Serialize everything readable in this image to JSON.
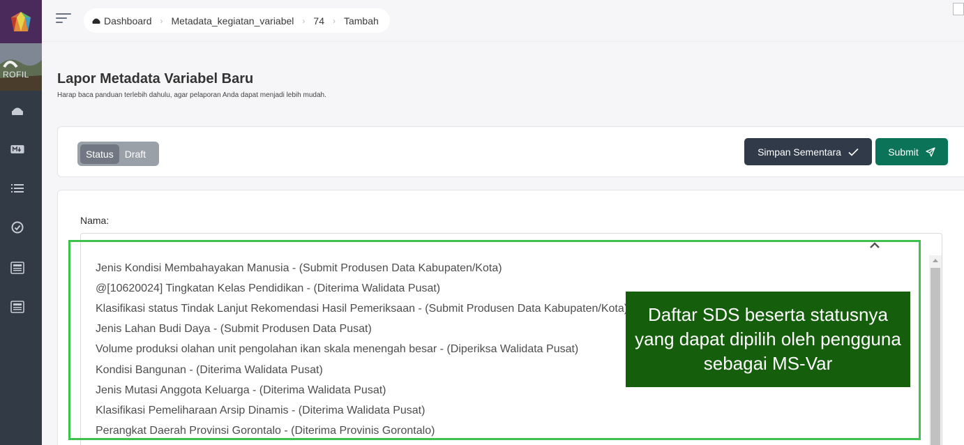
{
  "breadcrumb": {
    "items": [
      "Dashboard",
      "Metadata_kegiatan_variabel",
      "74",
      "Tambah"
    ]
  },
  "sidebar": {
    "brand_text": "ROFIL",
    "icons": [
      "home-icon",
      "md-icon",
      "list-icon",
      "check-circle-icon",
      "newspaper-icon",
      "newspaper-icon"
    ]
  },
  "page": {
    "title": "Lapor Metadata Variabel Baru",
    "subtitle": "Harap baca panduan terlebih dahulu, agar pelaporan Anda dapat menjadi lebih mudah."
  },
  "status_toggle": {
    "options": [
      "Status",
      "Draft"
    ],
    "selected": "Status"
  },
  "actions": {
    "save_label": "Simpan Sementara",
    "submit_label": "Submit"
  },
  "form": {
    "name_label": "Nama:",
    "dropdown_options": [
      "Jenis Kondisi Membahayakan Manusia - (Submit Produsen Data Kabupaten/Kota)",
      "@[10620024] Tingkatan Kelas Pendidikan - (Diterima Walidata Pusat)",
      "Klasifikasi status Tindak Lanjut Rekomendasi Hasil Pemeriksaan - (Submit Produsen Data Kabupaten/Kota)",
      "Jenis Lahan Budi Daya - (Submit Produsen Data Pusat)",
      "Volume produksi olahan unit pengolahan ikan skala menengah besar - (Diperiksa Walidata Pusat)",
      "Kondisi Bangunan - (Diterima Walidata Pusat)",
      "Jenis Mutasi Anggota Keluarga - (Diterima Walidata Pusat)",
      "Klasifikasi Pemeliharaan Arsip Dinamis - (Diterima Walidata Pusat)",
      "Perangkat Daerah Provinsi Gorontalo - (Diterima Provinis Gorontalo)"
    ]
  },
  "callout": {
    "text": "Daftar SDS beserta statusnya yang dapat dipilih oleh pengguna sebagai MS-Var"
  },
  "colors": {
    "sidebar": "#323a46",
    "save_button": "#313a48",
    "submit_button": "#0b7458",
    "highlight": "#3fc24d",
    "callout": "#155f0c"
  }
}
